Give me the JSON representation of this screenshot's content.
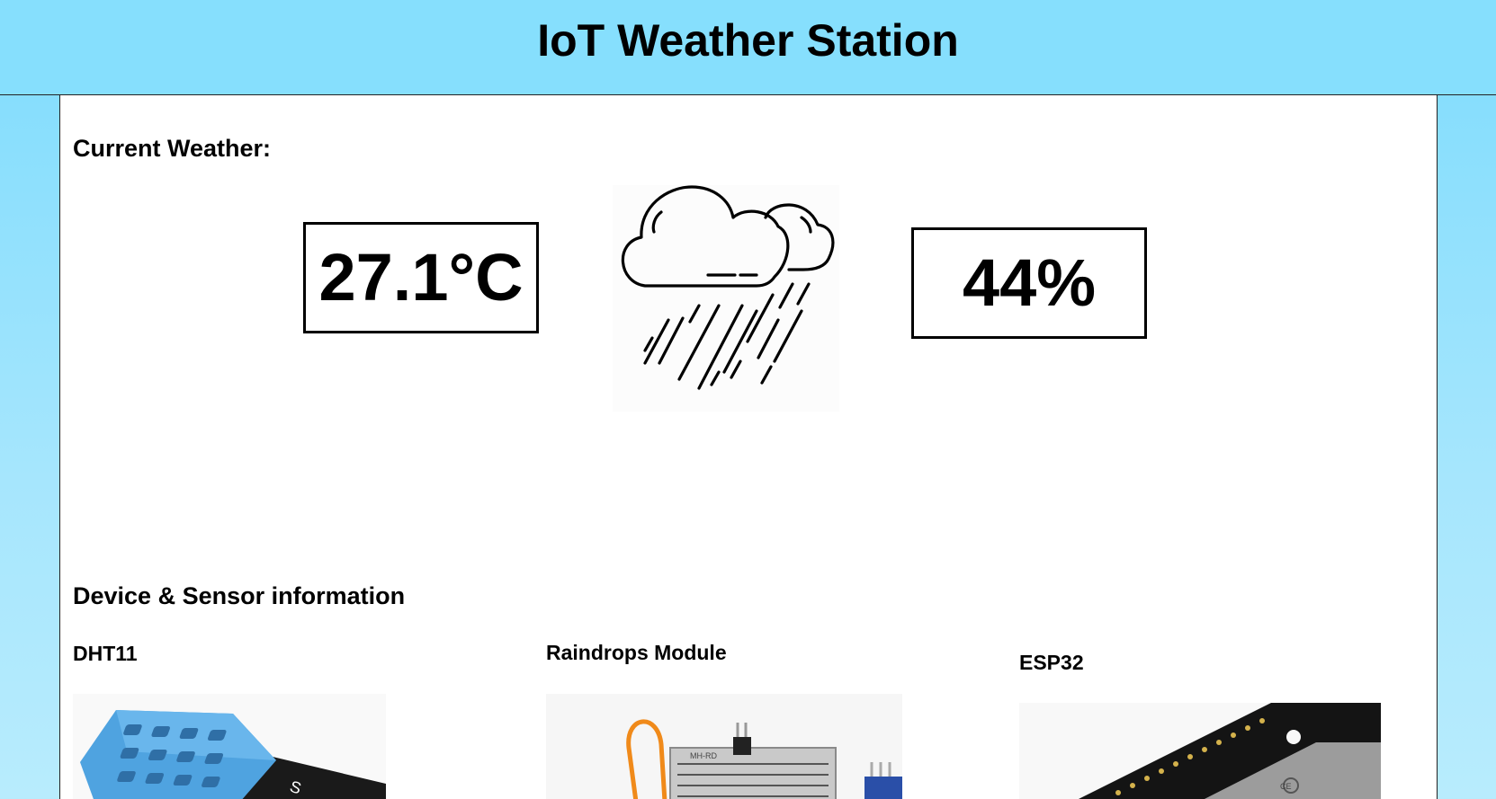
{
  "header": {
    "title": "IoT Weather Station"
  },
  "current_weather": {
    "heading": "Current Weather:",
    "temperature": "27.1°C",
    "humidity": "44%",
    "condition_icon": "rain-cloud-icon"
  },
  "devices": {
    "heading": "Device & Sensor information",
    "items": [
      {
        "label": "DHT11",
        "image": "dht11-sensor-image"
      },
      {
        "label": "Raindrops Module",
        "image": "raindrops-module-image"
      },
      {
        "label": "ESP32",
        "image": "esp32-board-image"
      }
    ]
  },
  "colors": {
    "header_bg": "#86dffd",
    "page_bg": "#a6e6fd",
    "content_bg": "#ffffff",
    "dht11_blue": "#4fa3e0"
  }
}
